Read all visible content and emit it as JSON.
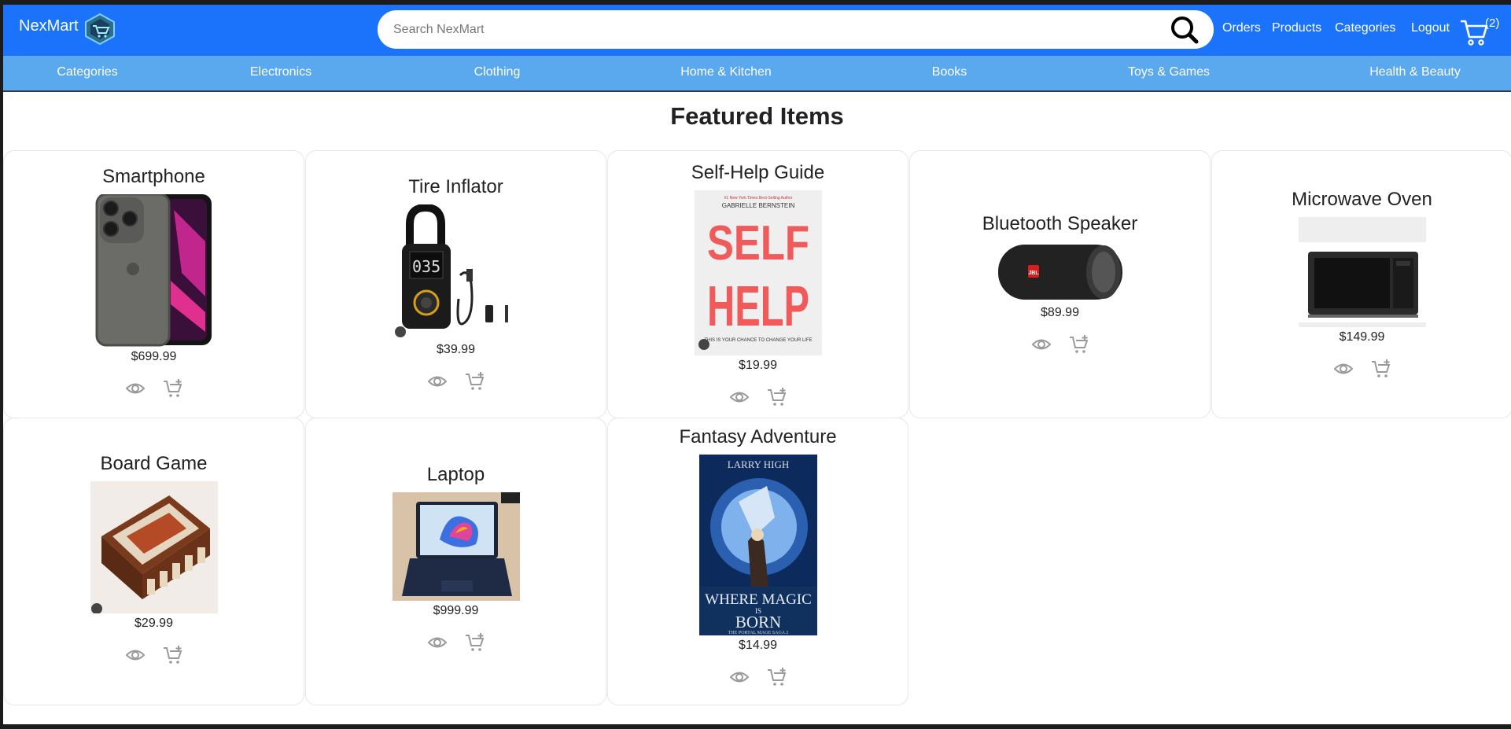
{
  "header": {
    "brand": "NexMart",
    "search_placeholder": "Search NexMart",
    "links": {
      "orders": "Orders",
      "products": "Products",
      "categories": "Categories",
      "logout": "Logout"
    },
    "cart_count": "(2)"
  },
  "category_nav": [
    "Categories",
    "Electronics",
    "Clothing",
    "Home & Kitchen",
    "Books",
    "Toys & Games",
    "Health & Beauty"
  ],
  "main": {
    "title": "Featured Items",
    "products": [
      {
        "name": "Smartphone",
        "price": "$699.99"
      },
      {
        "name": "Tire Inflator",
        "price": "$39.99"
      },
      {
        "name": "Self-Help Guide",
        "price": "$19.99",
        "image_text": {
          "top": "#1 New York Times Best-Selling Author",
          "author": "GABRIELLE BERNSTEIN",
          "line1": "SELF",
          "line2": "HELP",
          "tagline": "THIS IS YOUR CHANCE TO CHANGE YOUR LIFE"
        }
      },
      {
        "name": "Bluetooth Speaker",
        "price": "$89.99",
        "image_text": {
          "logo": "JBL"
        }
      },
      {
        "name": "Microwave Oven",
        "price": "$149.99"
      },
      {
        "name": "Board Game",
        "price": "$29.99"
      },
      {
        "name": "Laptop",
        "price": "$999.99"
      },
      {
        "name": "Fantasy Adventure",
        "price": "$14.99",
        "image_text": {
          "author": "LARRY HIGH",
          "line1": "WHERE MAGIC",
          "line2": "IS",
          "line3": "BORN",
          "series": "THE PORTAL MAGE SAGA 2"
        }
      }
    ]
  },
  "icons": {
    "view": "eye-icon",
    "add_to_cart": "cart-plus-icon",
    "search": "search-icon",
    "cart": "shopping-cart-icon"
  },
  "colors": {
    "header_bg": "#1a73fa",
    "category_bar_bg": "#5aa9ee",
    "action_icon": "#9a9a9a"
  }
}
